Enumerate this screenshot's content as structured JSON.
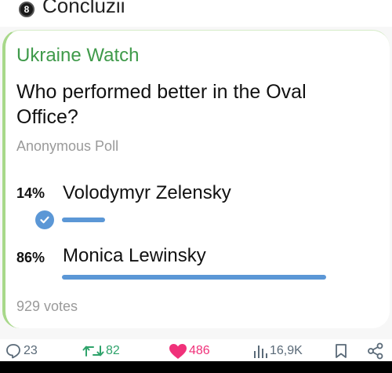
{
  "header": {
    "badge": "8",
    "title": "Concluzii"
  },
  "poll": {
    "channel": "Ukraine Watch",
    "question": "Who performed better in the Oval Office?",
    "type": "Anonymous Poll",
    "options": [
      {
        "percent": "14%",
        "label": "Volodymyr Zelensky",
        "fraction": 0.14,
        "selected": true
      },
      {
        "percent": "86%",
        "label": "Monica Lewinsky",
        "fraction": 0.86,
        "selected": false
      }
    ],
    "votes": "929 votes"
  },
  "actions": {
    "replies": "23",
    "reposts": "82",
    "likes": "486",
    "views": "16,9K"
  },
  "colors": {
    "channel": "#3f9a4a",
    "bar": "#5b97d6",
    "repost": "#2fa36b",
    "like": "#f0317a",
    "icon": "#5a6a78"
  }
}
